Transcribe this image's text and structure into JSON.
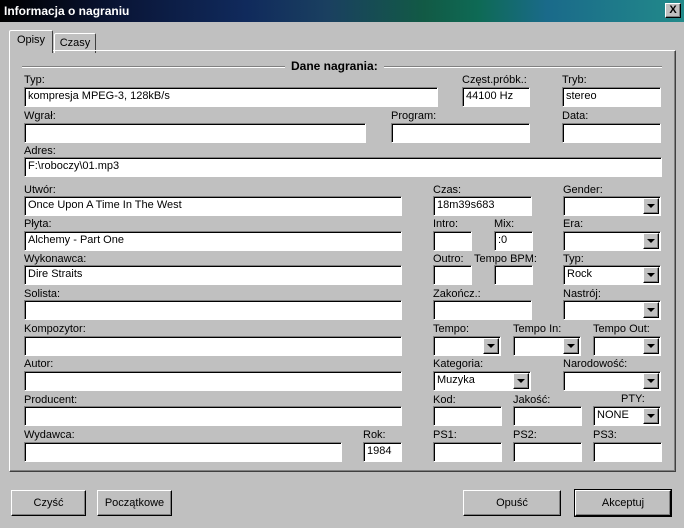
{
  "window": {
    "title": "Informacja o nagraniu",
    "close_label": "X"
  },
  "tabs": [
    {
      "label": "Opisy"
    },
    {
      "label": "Czasy"
    }
  ],
  "group_title": "Dane nagrania:",
  "fields": {
    "typ": {
      "label": "Typ:",
      "value": "kompresja MPEG-3,    128kB/s"
    },
    "czest": {
      "label": "Częst.próbk.:",
      "value": "44100 Hz"
    },
    "tryb": {
      "label": "Tryb:",
      "value": "stereo"
    },
    "wgral": {
      "label": "Wgrał:",
      "value": ""
    },
    "program": {
      "label": "Program:",
      "value": ""
    },
    "data": {
      "label": "Data:",
      "value": ""
    },
    "adres": {
      "label": "Adres:",
      "value": "F:\\roboczy\\01.mp3"
    },
    "utwor": {
      "label": "Utwór:",
      "value": "Once Upon A Time In The West"
    },
    "czas": {
      "label": "Czas:",
      "value": "18m39s683"
    },
    "gender": {
      "label": "Gender:",
      "value": ""
    },
    "plyta": {
      "label": "Płyta:",
      "value": "Alchemy - Part One"
    },
    "intro": {
      "label": "Intro:",
      "value": ""
    },
    "mix": {
      "label": "Mix:",
      "value": ":0"
    },
    "era": {
      "label": "Era:",
      "value": ""
    },
    "wykonawca": {
      "label": "Wykonawca:",
      "value": "Dire Straits"
    },
    "outro": {
      "label": "Outro:",
      "value": ""
    },
    "tempo_bpm": {
      "label": "Tempo BPM:",
      "value": ""
    },
    "typ2": {
      "label": "Typ:",
      "value": "Rock"
    },
    "solista": {
      "label": "Solista:",
      "value": ""
    },
    "zakoncz": {
      "label": "Zakończ.:",
      "value": ""
    },
    "nastroj": {
      "label": "Nastrój:",
      "value": ""
    },
    "kompozytor": {
      "label": "Kompozytor:",
      "value": ""
    },
    "tempo": {
      "label": "Tempo:",
      "value": ""
    },
    "tempo_in": {
      "label": "Tempo In:",
      "value": ""
    },
    "tempo_out": {
      "label": "Tempo Out:",
      "value": ""
    },
    "autor": {
      "label": "Autor:",
      "value": ""
    },
    "kategoria": {
      "label": "Kategoria:",
      "value": "Muzyka"
    },
    "narodowosc": {
      "label": "Narodowość:",
      "value": ""
    },
    "producent": {
      "label": "Producent:",
      "value": ""
    },
    "kod": {
      "label": "Kod:",
      "value": ""
    },
    "jakosc": {
      "label": "Jakość:",
      "value": ""
    },
    "pty": {
      "label": "PTY:",
      "value": "NONE"
    },
    "wydawca": {
      "label": "Wydawca:",
      "value": ""
    },
    "rok": {
      "label": "Rok:",
      "value": "1984"
    },
    "ps1": {
      "label": "PS1:",
      "value": ""
    },
    "ps2": {
      "label": "PS2:",
      "value": ""
    },
    "ps3": {
      "label": "PS3:",
      "value": ""
    }
  },
  "buttons": {
    "clear": "Czyść",
    "initial": "Początkowe",
    "cancel": "Opuść",
    "accept": "Akceptuj"
  }
}
